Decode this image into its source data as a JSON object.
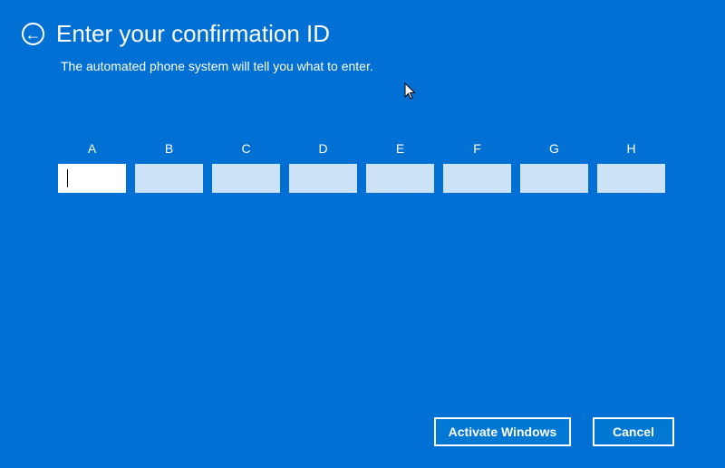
{
  "header": {
    "title": "Enter your confirmation ID",
    "subtitle": "The automated phone system will tell you what to enter."
  },
  "fields": [
    {
      "label": "A",
      "value": ""
    },
    {
      "label": "B",
      "value": ""
    },
    {
      "label": "C",
      "value": ""
    },
    {
      "label": "D",
      "value": ""
    },
    {
      "label": "E",
      "value": ""
    },
    {
      "label": "F",
      "value": ""
    },
    {
      "label": "G",
      "value": ""
    },
    {
      "label": "H",
      "value": ""
    }
  ],
  "buttons": {
    "activate": "Activate Windows",
    "cancel": "Cancel"
  }
}
